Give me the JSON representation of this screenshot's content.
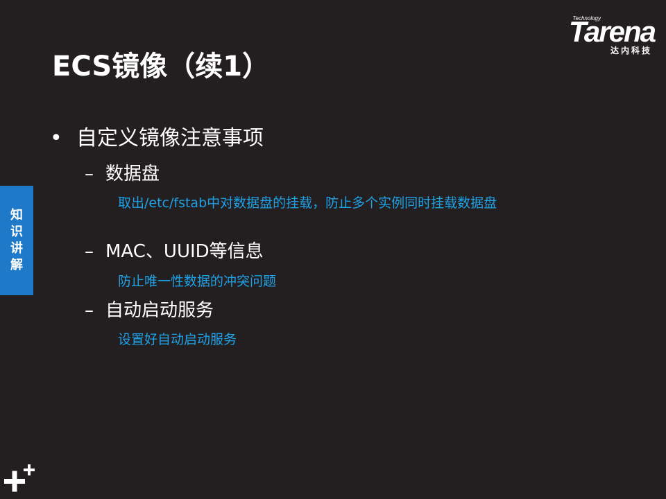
{
  "logo": {
    "technology": "Technology",
    "brand": "Tarena",
    "cn": "达内科技"
  },
  "title": "ECS镜像（续1）",
  "side_tab": [
    "知",
    "识",
    "讲",
    "解"
  ],
  "main": {
    "bullet_marker": "•",
    "bullet": "自定义镜像注意事项",
    "dash": "–",
    "subitems": [
      {
        "label": "数据盘",
        "detail": "取出/etc/fstab中对数据盘的挂载，防止多个实例同时挂载数据盘"
      },
      {
        "label": "MAC、UUID等信息",
        "detail": "防止唯一性数据的冲突问题"
      },
      {
        "label": "自动启动服务",
        "detail": "设置好自动启动服务"
      }
    ]
  },
  "colors": {
    "background": "#231f20",
    "text": "#ffffff",
    "detail_text": "#1fa1e6",
    "side_tab": "#1f79c9"
  },
  "icons": [
    "plus-plus-icon"
  ]
}
